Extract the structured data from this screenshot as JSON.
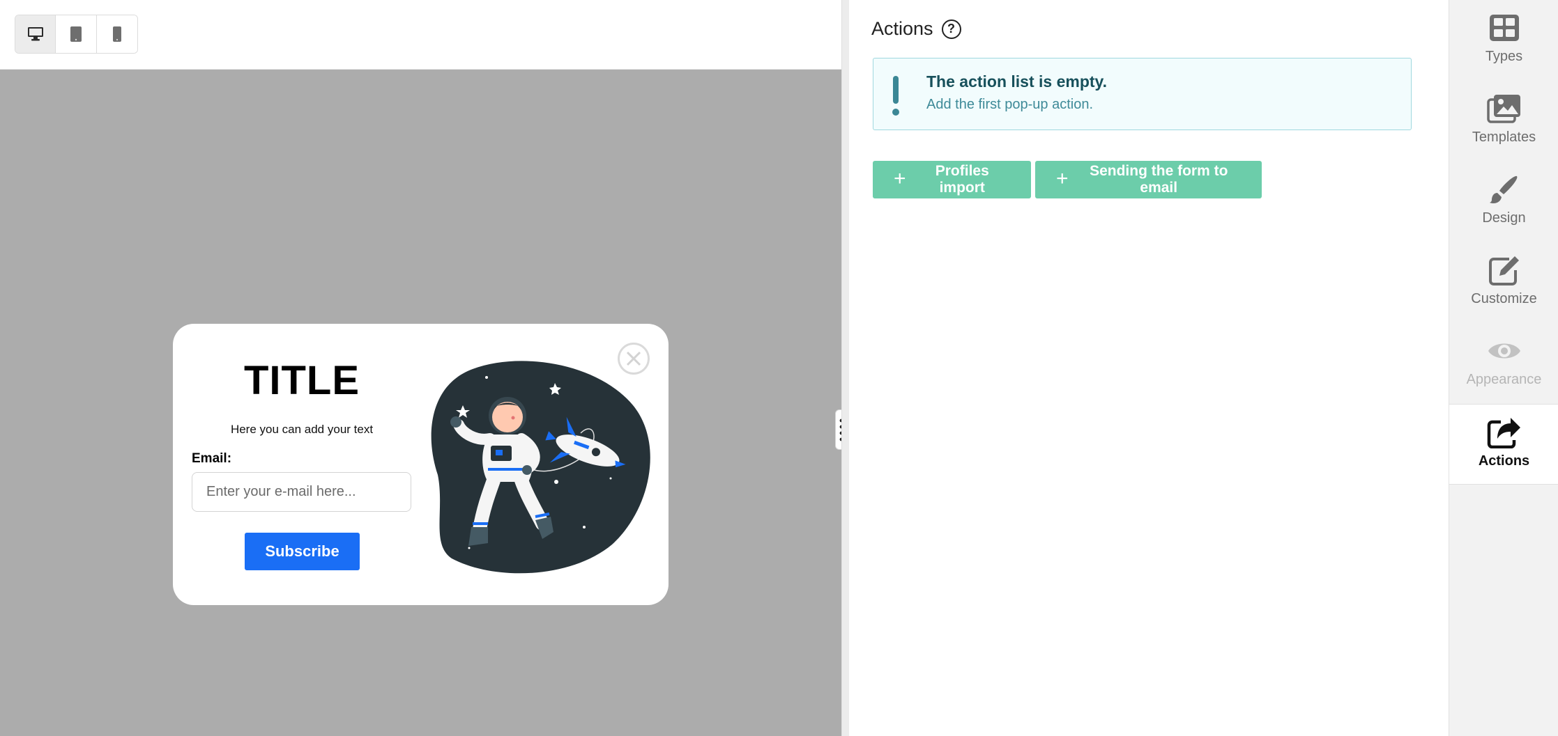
{
  "device_bar": {
    "devices": [
      {
        "name": "desktop",
        "icon": "desktop-icon",
        "active": true
      },
      {
        "name": "tablet",
        "icon": "tablet-icon",
        "active": false
      },
      {
        "name": "mobile",
        "icon": "mobile-icon",
        "active": false
      }
    ]
  },
  "popup": {
    "title": "TITLE",
    "text": "Here you can add your text",
    "email_label": "Email:",
    "email_placeholder": "Enter your e-mail here...",
    "subscribe_label": "Subscribe",
    "close_icon": "close-circle-icon",
    "illustration": "astronaut-rocket-illustration"
  },
  "panel": {
    "title": "Actions",
    "help_icon": "?",
    "alert": {
      "title": "The action list is empty.",
      "subtitle": "Add the first pop-up action."
    },
    "buttons": [
      {
        "label": "Profiles import"
      },
      {
        "label": "Sending the form to email"
      }
    ]
  },
  "sidebar": {
    "items": [
      {
        "label": "Types",
        "icon": "grid-icon",
        "state": "normal"
      },
      {
        "label": "Templates",
        "icon": "images-icon",
        "state": "normal"
      },
      {
        "label": "Design",
        "icon": "brush-icon",
        "state": "normal"
      },
      {
        "label": "Customize",
        "icon": "edit-icon",
        "state": "normal"
      },
      {
        "label": "Appearance",
        "icon": "eye-icon",
        "state": "disabled"
      },
      {
        "label": "Actions",
        "icon": "share-icon",
        "state": "active"
      }
    ]
  },
  "colors": {
    "canvas_bg": "#acacac",
    "subscribe_blue": "#1a6ef5",
    "action_green": "#6ccdaa",
    "alert_bg": "#f2fcfd",
    "alert_border": "#9fd8df",
    "alert_title": "#17505b",
    "alert_text": "#3e8a98"
  }
}
